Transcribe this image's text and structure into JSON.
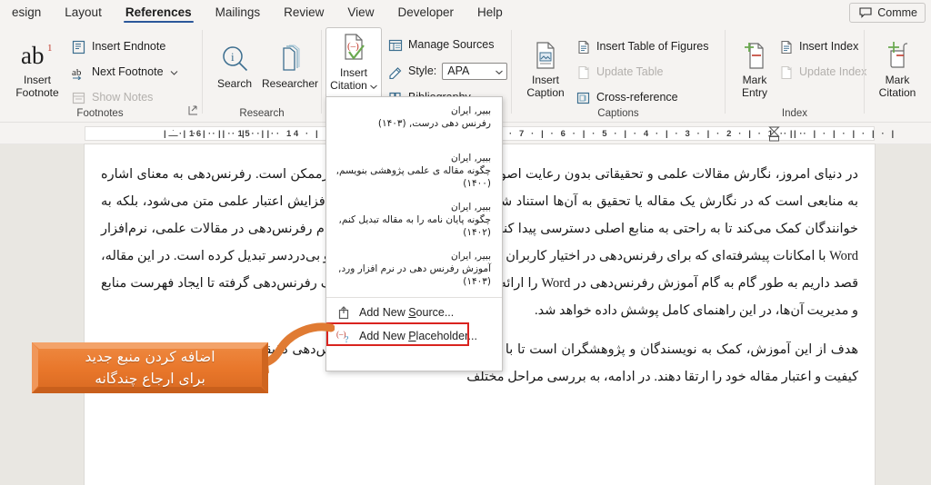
{
  "window": {
    "app": "Microsoft Word",
    "comment_button": "Comme"
  },
  "tabs": [
    {
      "label": "esign",
      "active": false
    },
    {
      "label": "Layout",
      "active": false
    },
    {
      "label": "References",
      "active": true
    },
    {
      "label": "Mailings",
      "active": false
    },
    {
      "label": "Review",
      "active": false
    },
    {
      "label": "View",
      "active": false
    },
    {
      "label": "Developer",
      "active": false
    },
    {
      "label": "Help",
      "active": false
    }
  ],
  "ribbon": {
    "groups": [
      {
        "name": "Footnotes",
        "label": "Footnotes",
        "big_button": {
          "line1": "Insert",
          "line2": "Footnote",
          "icon": "ab-superscript-icon"
        },
        "items": [
          {
            "label": "Insert Endnote",
            "icon": "insert-endnote-icon",
            "disabled": false
          },
          {
            "label": "Next Footnote",
            "icon": "next-footnote-icon",
            "disabled": false,
            "has_chevron": true
          },
          {
            "label": "Show Notes",
            "icon": "show-notes-icon",
            "disabled": true
          }
        ],
        "has_dialog_launcher": true
      },
      {
        "name": "Research",
        "label": "Research",
        "buttons": [
          {
            "label": "Search",
            "icon": "search-icon"
          },
          {
            "label": "Researcher",
            "icon": "researcher-books-icon"
          }
        ]
      },
      {
        "name": "CitationsBibliography",
        "label": "",
        "big_button": {
          "line1": "Insert",
          "line2": "Citation",
          "icon": "insert-citation-icon",
          "has_chevron": true,
          "pressed": true
        },
        "items": [
          {
            "label": "Manage Sources",
            "icon": "manage-sources-icon",
            "disabled": false
          },
          {
            "label": "Style:",
            "icon": "style-icon",
            "disabled": false,
            "select_value": "APA"
          },
          {
            "label": "Bibliography",
            "icon": "bibliography-icon",
            "disabled": false,
            "has_chevron": true
          }
        ]
      },
      {
        "name": "Captions",
        "label": "Captions",
        "big_button": {
          "line1": "Insert",
          "line2": "Caption",
          "icon": "insert-caption-icon"
        },
        "items": [
          {
            "label": "Insert Table of Figures",
            "icon": "table-of-figures-icon",
            "disabled": false
          },
          {
            "label": "Update Table",
            "icon": "update-table-icon",
            "disabled": true
          },
          {
            "label": "Cross-reference",
            "icon": "cross-reference-icon",
            "disabled": false
          }
        ]
      },
      {
        "name": "Index",
        "label": "Index",
        "big_button": {
          "line1": "Mark",
          "line2": "Entry",
          "icon": "mark-entry-icon"
        },
        "items": [
          {
            "label": "Insert Index",
            "icon": "insert-index-icon",
            "disabled": false
          },
          {
            "label": "Update Index",
            "icon": "update-index-icon",
            "disabled": true
          }
        ]
      },
      {
        "name": "TableOfAuthorities",
        "label": "",
        "big_button": {
          "line1": "Mark",
          "line2": "Citation",
          "icon": "mark-citation-icon"
        }
      }
    ]
  },
  "ruler": {
    "left_ticks": "|  ·  |  ·  |  ·  |  ·  |  ·  |  · ",
    "left_numbers": "· 16 ·  |  · 15 ·  |  · 14 ·  |  · 13 ·  |",
    "right_numbers": "· 7 ·  |  · 6 ·  |  · 5 ·  |  · 4 ·  |  · 3 ·  |  · 2 ·  |  · 1 ·  |  ·",
    "right_ticks": "·  |  ·  |  ·  |  ·  |  ·  |  ·  |"
  },
  "menu": {
    "name": "insert-citation-dropdown",
    "sources": [
      {
        "author": "ببیر, ایران",
        "title": "رفرنس دهی درست, (۱۴۰۳)"
      },
      {
        "author": "ببیر, ایران",
        "title": "چگونه مقاله ی علمی پژوهشی بنویسم, (۱۴۰۰)"
      },
      {
        "author": "ببیر, ایران",
        "title": "چگونه پایان نامه را به مقاله تبدیل کنم, (۱۴۰۲)"
      },
      {
        "author": "ببیر, ایران",
        "title": "آموزش رفرنس دهی در نرم افزار ورد, (۱۴۰۳)"
      }
    ],
    "commands": [
      {
        "label_pre": "Add New ",
        "accel": "S",
        "label_post": "ource...",
        "icon": "add-new-source-icon",
        "highlighted": true
      },
      {
        "label_pre": "Add New ",
        "accel": "P",
        "label_post": "laceholder...",
        "icon": "add-new-placeholder-icon",
        "highlighted": false
      }
    ],
    "highlight_color": "#d9231f"
  },
  "callout": {
    "line1": "اضافه کردن منبع جدید",
    "line2": "برای ارجاع چندگانه",
    "fill_color": "#e8762a",
    "arrow_color": "#e07b33"
  },
  "document": {
    "paragraphs": [
      "در دنیای امروز، نگارش مقالات علمی و تحقیقاتی بدون رعایت اصول درست رفرنس‌دهی، تقریبا غیرممکن است. رفرنس‌دهی به معنای اشاره به منابعی است که در نگارش یک مقاله یا تحقیق به آن‌ها استناد شده است. این کار نه تنها موجب افزایش اعتبار علمی متن می‌شود، بلکه به خوانندگان کمک می‌کند تا به راحتی به منابع اصلی دسترسی پیدا کنند یکی از ابزارهای رایج برای انجام رفرنس‌دهی در مقالات علمی، نرم‌افزار Word با امکانات پیشرفته‌ای که برای رفرنس‌دهی در اختیار کاربران قرار می‌دهد، این فرآیند را ساده و بی‌دردسر تبدیل کرده است. در این مقاله، قصد داریم به طور گام به گام آموزش رفرنس‌دهی در Word را ارائه دهیم. از انتخاب سبک‌های مختلف رفرنس‌دهی گرفته تا ایجاد فهرست منابع و مدیریت آن‌ها، در این راهنمای کامل پوشش داده خواهد شد.",
      "هدف از این آموزش، کمک به نویسندگان و پژوهشگران است تا با استفاده از امکاناتWord ، رفرنس‌دهی دقیقی داشته باشند و از این طریق کیفیت و اعتبار مقاله خود را ارتقا دهند. در ادامه، به بررسی مراحل مختلف"
    ]
  }
}
